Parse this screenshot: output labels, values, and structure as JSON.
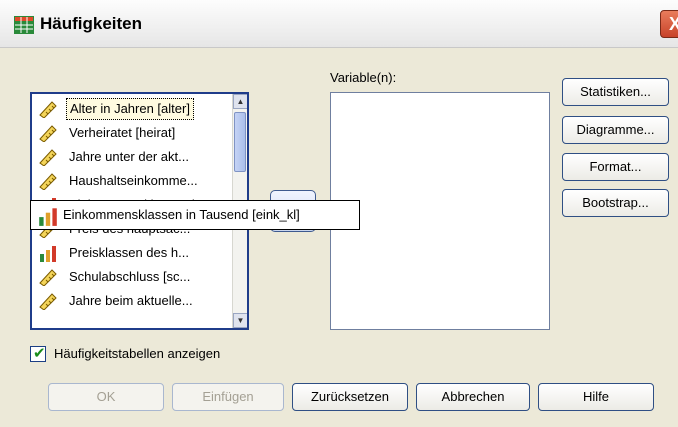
{
  "window": {
    "title": "Häufigkeiten",
    "close_label": "X"
  },
  "variables_list": {
    "items": [
      {
        "label": "Alter in Jahren [alter]",
        "icon": "ruler-icon",
        "selected": true
      },
      {
        "label": "Verheiratet [heirat]",
        "icon": "ruler-icon"
      },
      {
        "label": "Jahre unter der akt...",
        "icon": "ruler-icon"
      },
      {
        "label": "Haushaltseinkomme...",
        "icon": "ruler-icon"
      },
      {
        "label": "Einkommensklassen in Tausend [eink_kl]",
        "icon": "bar-chart-icon"
      },
      {
        "label": "Preis des hauptsäc...",
        "icon": "ruler-icon"
      },
      {
        "label": "Preisklassen des h...",
        "icon": "bar-chart-icon"
      },
      {
        "label": "Schulabschluss [sc...",
        "icon": "ruler-icon"
      },
      {
        "label": "Jahre beim aktuelle...",
        "icon": "ruler-icon"
      }
    ]
  },
  "tooltip": {
    "label": "Einkommensklassen in Tausend [eink_kl]",
    "icon": "bar-chart-icon"
  },
  "target": {
    "label": "Variable(n):"
  },
  "side_buttons": {
    "statistiken": "Statistiken...",
    "diagramme": "Diagramme...",
    "format": "Format...",
    "bootstrap": "Bootstrap..."
  },
  "checkbox": {
    "label": "Häufigkeitstabellen anzeigen",
    "checked": true
  },
  "bottom_buttons": {
    "ok": "OK",
    "einfuegen": "Einfügen",
    "zuruecksetzen": "Zurücksetzen",
    "abbrechen": "Abbrechen",
    "hilfe": "Hilfe"
  },
  "colors": {
    "dialog_bg": "#ece9d8",
    "accent_border": "#2f4f84",
    "listbox_border": "#1f3c8a",
    "disabled_text": "#a4a094"
  }
}
